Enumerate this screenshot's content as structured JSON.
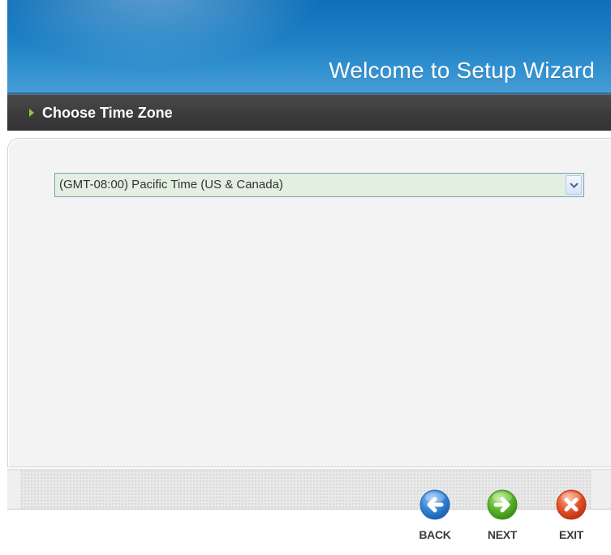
{
  "header": {
    "title": "Welcome to Setup Wizard"
  },
  "section": {
    "title": "Choose Time Zone"
  },
  "timezone_select": {
    "selected": "(GMT-08:00) Pacific Time (US & Canada)"
  },
  "nav": {
    "back_label": "BACK",
    "next_label": "NEXT",
    "exit_label": "EXIT"
  },
  "colors": {
    "header_blue": "#1c7fc4",
    "title_bar": "#3b3b3b",
    "bullet_green": "#8dc83f",
    "select_bg": "#e3efe1",
    "back_blue": "#3a86d8",
    "next_green": "#5cb82e",
    "exit_red": "#e8542a"
  }
}
